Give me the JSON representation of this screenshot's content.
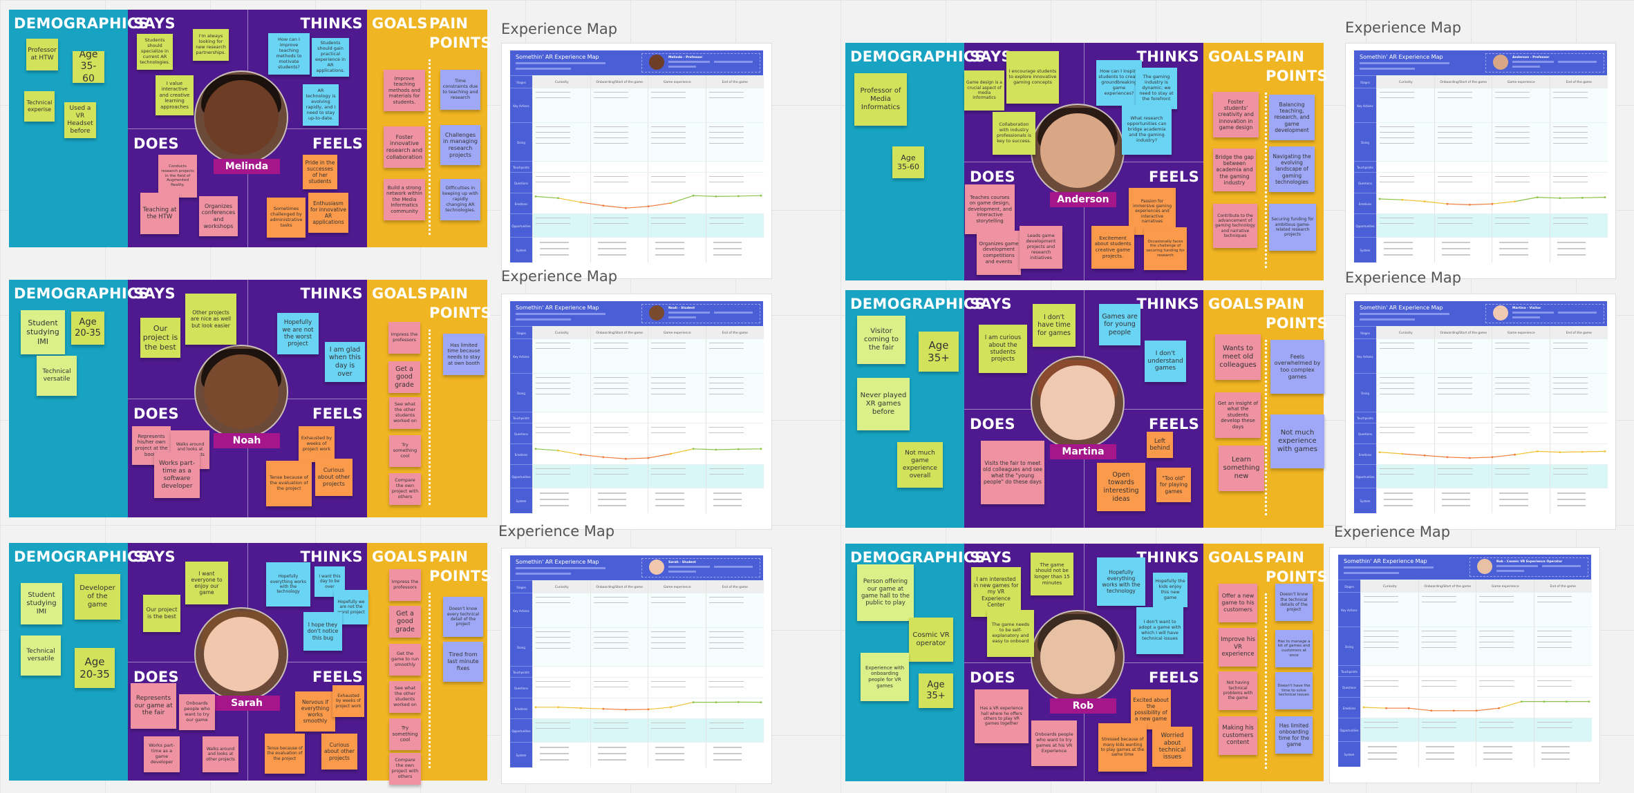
{
  "canvas": {
    "app": "Whiteboard"
  },
  "section_headers": {
    "demographics": "DEMOGRAPHICS",
    "says": "SAYS",
    "thinks": "THINKS",
    "does": "DOES",
    "feels": "FEELS",
    "goals": "GOALS",
    "pain_1": "PAIN",
    "pain_2": "POINTS"
  },
  "colors": {
    "demographics_bg": "#17a3c1",
    "empathy_bg": "#4f1a8f",
    "goals_bg": "#f0b522",
    "name_tag": "#a4168a",
    "note_demographics": "#d2e25a",
    "note_says": "#d2e25a",
    "note_thinks": "#6ad4f5",
    "note_does": "#ef93a3",
    "note_feels": "#fb9a4b",
    "note_goals": "#ef93a3",
    "note_pain": "#9ea8f6",
    "map_header": "#4a5fd6"
  },
  "personas": [
    {
      "name": "Melinda",
      "demographics": [
        "Professor at HTW",
        "Age 35-60",
        "Technical experise",
        "Used a VR Headset before"
      ],
      "says": [
        "Students should specialize in current AR technologies.",
        "I'm always looking for new research partnerships.",
        "I value interactive and creative learning approaches"
      ],
      "thinks": [
        "How can I improve teaching methods to motivate students?",
        "Students should gain practical experience in AR applications.",
        "AR technology is evolving rapidly, and I need to stay up-to-date."
      ],
      "does": [
        "Conducts research projects in the field of Augmented Reality.",
        "Teaching at the HTW",
        "Organizes conferences and workshops"
      ],
      "feels": [
        "Pride in the successes of her students",
        "Sometimes challenged by administrative tasks",
        "Enthusiasm for innovative AR applications"
      ],
      "goals": [
        "Improve teaching methods and materials for students.",
        "Foster innovative research and collaboration",
        "Build a strong network within the Media Informatics community"
      ],
      "pain_points": [
        "Time constraints due to teaching and research",
        "Challenges in managing research projects",
        "Difficulties in keeping up with rapidly changing AR technologies."
      ]
    },
    {
      "name": "Noah",
      "demographics": [
        "Student studying IMI",
        "Age 20-35",
        "Technical versatile"
      ],
      "says": [
        "Our project is the best",
        "Other projects are nice as well but look easier"
      ],
      "thinks": [
        "Hopefully we are not the worst project",
        "I am glad when this day is over"
      ],
      "does": [
        "Represents his/her own project at the booth",
        "Walks around and looks at other projects",
        "Works part-time as a software developer"
      ],
      "feels": [
        "Exhausted by weeks of project work",
        "Tense because of the evaluation of the project",
        "Curious about other projects"
      ],
      "goals": [
        "Impress the professors",
        "Get a good grade",
        "See what the other students worked on",
        "Try something cool",
        "Compare the own project with others"
      ],
      "pain_points": [
        "Has limited time because needs to stay at own booth"
      ]
    },
    {
      "name": "Sarah",
      "demographics": [
        "Student studying IMI",
        "Developer of the game",
        "Technical versatile",
        "Age 20-35"
      ],
      "says": [
        "Our project is the best",
        "I want everyone to enjoy our game"
      ],
      "thinks": [
        "Hopefully everything works with the technology",
        "I want this day to be over",
        "Hopefully we are not the worst project",
        "I hope they don't notice this bug"
      ],
      "does": [
        "Represents our game at the fair",
        "Onboards people who want to try our game",
        "Works part-time as a game developer",
        "Walks around and looks at other projects"
      ],
      "feels": [
        "Nervous if everything works smoothly",
        "Exhausted by weeks of project work",
        "Tense because of the evaluation of the project",
        "Curious about other projects"
      ],
      "goals": [
        "Impress the professors",
        "Get a good grade",
        "Get the game to run smoothly",
        "See what the other students worked on",
        "Try something cool",
        "Compare the own project with others"
      ],
      "pain_points": [
        "Doesn't know every technical detail of the project",
        "Tired from last minute fixes"
      ]
    },
    {
      "name": "Anderson",
      "demographics": [
        "Professor of Media Informatics",
        "Age 35-60"
      ],
      "says": [
        "Game design is a crucial aspect of media informatics",
        "I encourage students to explore innovative gaming concepts",
        "Collaboration with industry professionals is key to success."
      ],
      "thinks": [
        "How can I inspire students to create groundbreaking game experiences?",
        "The gaming industry is dynamic; we need to stay at the forefront",
        "What research opportunities can bridge academia and the gaming industry?"
      ],
      "does": [
        "Teaches courses on game design, development, and interactive storytelling",
        "Organizes game development competitions and events",
        "Leads game development projects and research initiatives"
      ],
      "feels": [
        "Passion for immersive gaming experiences and interactive narratives",
        "Excitement about students creative game projects.",
        "Occasionally faces the challenge of securing funding for research"
      ],
      "goals": [
        "Foster students' creativity and innovation in game design",
        "Bridge the gap between academia and the gaming industry",
        "Contribute to the advancement of gaming technology and narrative techniques"
      ],
      "pain_points": [
        "Balancing teaching, research, and game development",
        "Navigating the evolving landscape of gaming technologies",
        "Securing funding for ambitious game-related research projects"
      ]
    },
    {
      "name": "Martina",
      "demographics": [
        "Visitor coming to the fair",
        "Age 35+",
        "Never played XR games before",
        "Not much game experience overall"
      ],
      "says": [
        "I am curious about the students projects",
        "I don't have time for games"
      ],
      "thinks": [
        "Games are for young people",
        "I don't understand games"
      ],
      "does": [
        "Visits the fair to meet old colleagues and see what the \"young people\" do these days"
      ],
      "feels": [
        "Left behind",
        "Open towards interesting ideas",
        "\"Too old\" for playing games"
      ],
      "goals": [
        "Wants to meet old colleagues",
        "Get an insight of what the students develop these days",
        "Learn something new"
      ],
      "pain_points": [
        "Feels overwhelmed by too complex games",
        "Not much experience with games"
      ]
    },
    {
      "name": "Rob",
      "demographics": [
        "Person offering our game at game hall to the public to play",
        "Cosmic VR operator",
        "Experience with onboarding people for VR games",
        "Age 35+"
      ],
      "says": [
        "I am interested in new games for my VR Experience Center",
        "The game should not be longer than 15 minutes",
        "The game needs to be self-explanatory and easy to onboard"
      ],
      "thinks": [
        "Hopefully everything works with the technology",
        "Hopefully the kids enjoy this new game",
        "I don't want to adopt a game with which I will have technical issues"
      ],
      "does": [
        "Has a VR experience hall where he offers others to play VR games together",
        "Onboards people who want to try games at his VR Experience"
      ],
      "feels": [
        "Excited about the possibility of a new game",
        "Stressed because of many kids wanting to play games at the same time",
        "Worried about technical issues"
      ],
      "goals": [
        "Offer a new game to his customers",
        "Improve his VR experience",
        "Not having technical problems with the game",
        "Making his customers content"
      ],
      "pain_points": [
        "Doesn't know the technical details of the project",
        "Has to manage a lot of games and customers at once",
        "Doesn't have the time to solve technical issues",
        "Has limited onboarding time for the game"
      ]
    }
  ],
  "experience_maps": {
    "section_title": "Experience Map",
    "map_title": "Somethin' AR Experience Map",
    "row_labels": [
      "Stages",
      "Key Actions",
      "Doing",
      "Touchpoints",
      "Questions",
      "Emotions",
      "Opportunities",
      "System"
    ],
    "stages": [
      "Curiosity",
      "Onboarding/Start of the game",
      "Game experience",
      "End of the game"
    ],
    "maps": [
      {
        "persona_label": "Melinda - Professor",
        "emotions": [
          0.9,
          0.8,
          0.55,
          0.35,
          0.2,
          0.3,
          0.5,
          0.95,
          0.9,
          0.92,
          0.95
        ]
      },
      {
        "persona_label": "Noah - Student",
        "emotions": [
          0.8,
          0.7,
          0.45,
          0.3,
          0.2,
          0.25,
          0.5,
          0.8,
          0.75,
          0.78,
          0.8
        ]
      },
      {
        "persona_label": "Sarah - Student",
        "emotions": [
          0.55,
          0.55,
          0.5,
          0.45,
          0.4,
          0.42,
          0.55,
          0.85,
          0.85,
          0.86,
          0.85
        ]
      },
      {
        "persona_label": "Anderson - Professor",
        "emotions": [
          0.75,
          0.7,
          0.6,
          0.45,
          0.4,
          0.45,
          0.6,
          0.85,
          0.8,
          0.82,
          0.85
        ]
      },
      {
        "persona_label": "Martina - Visitor",
        "emotions": [
          0.6,
          0.5,
          0.4,
          0.3,
          0.25,
          0.3,
          0.45,
          0.65,
          0.6,
          0.62,
          0.65
        ]
      },
      {
        "persona_label": "Rob - Cosmic VR Experience Operator",
        "emotions": [
          0.5,
          0.45,
          0.45,
          0.3,
          0.3,
          0.3,
          0.45,
          0.85,
          0.85,
          0.85,
          0.85
        ]
      }
    ]
  }
}
